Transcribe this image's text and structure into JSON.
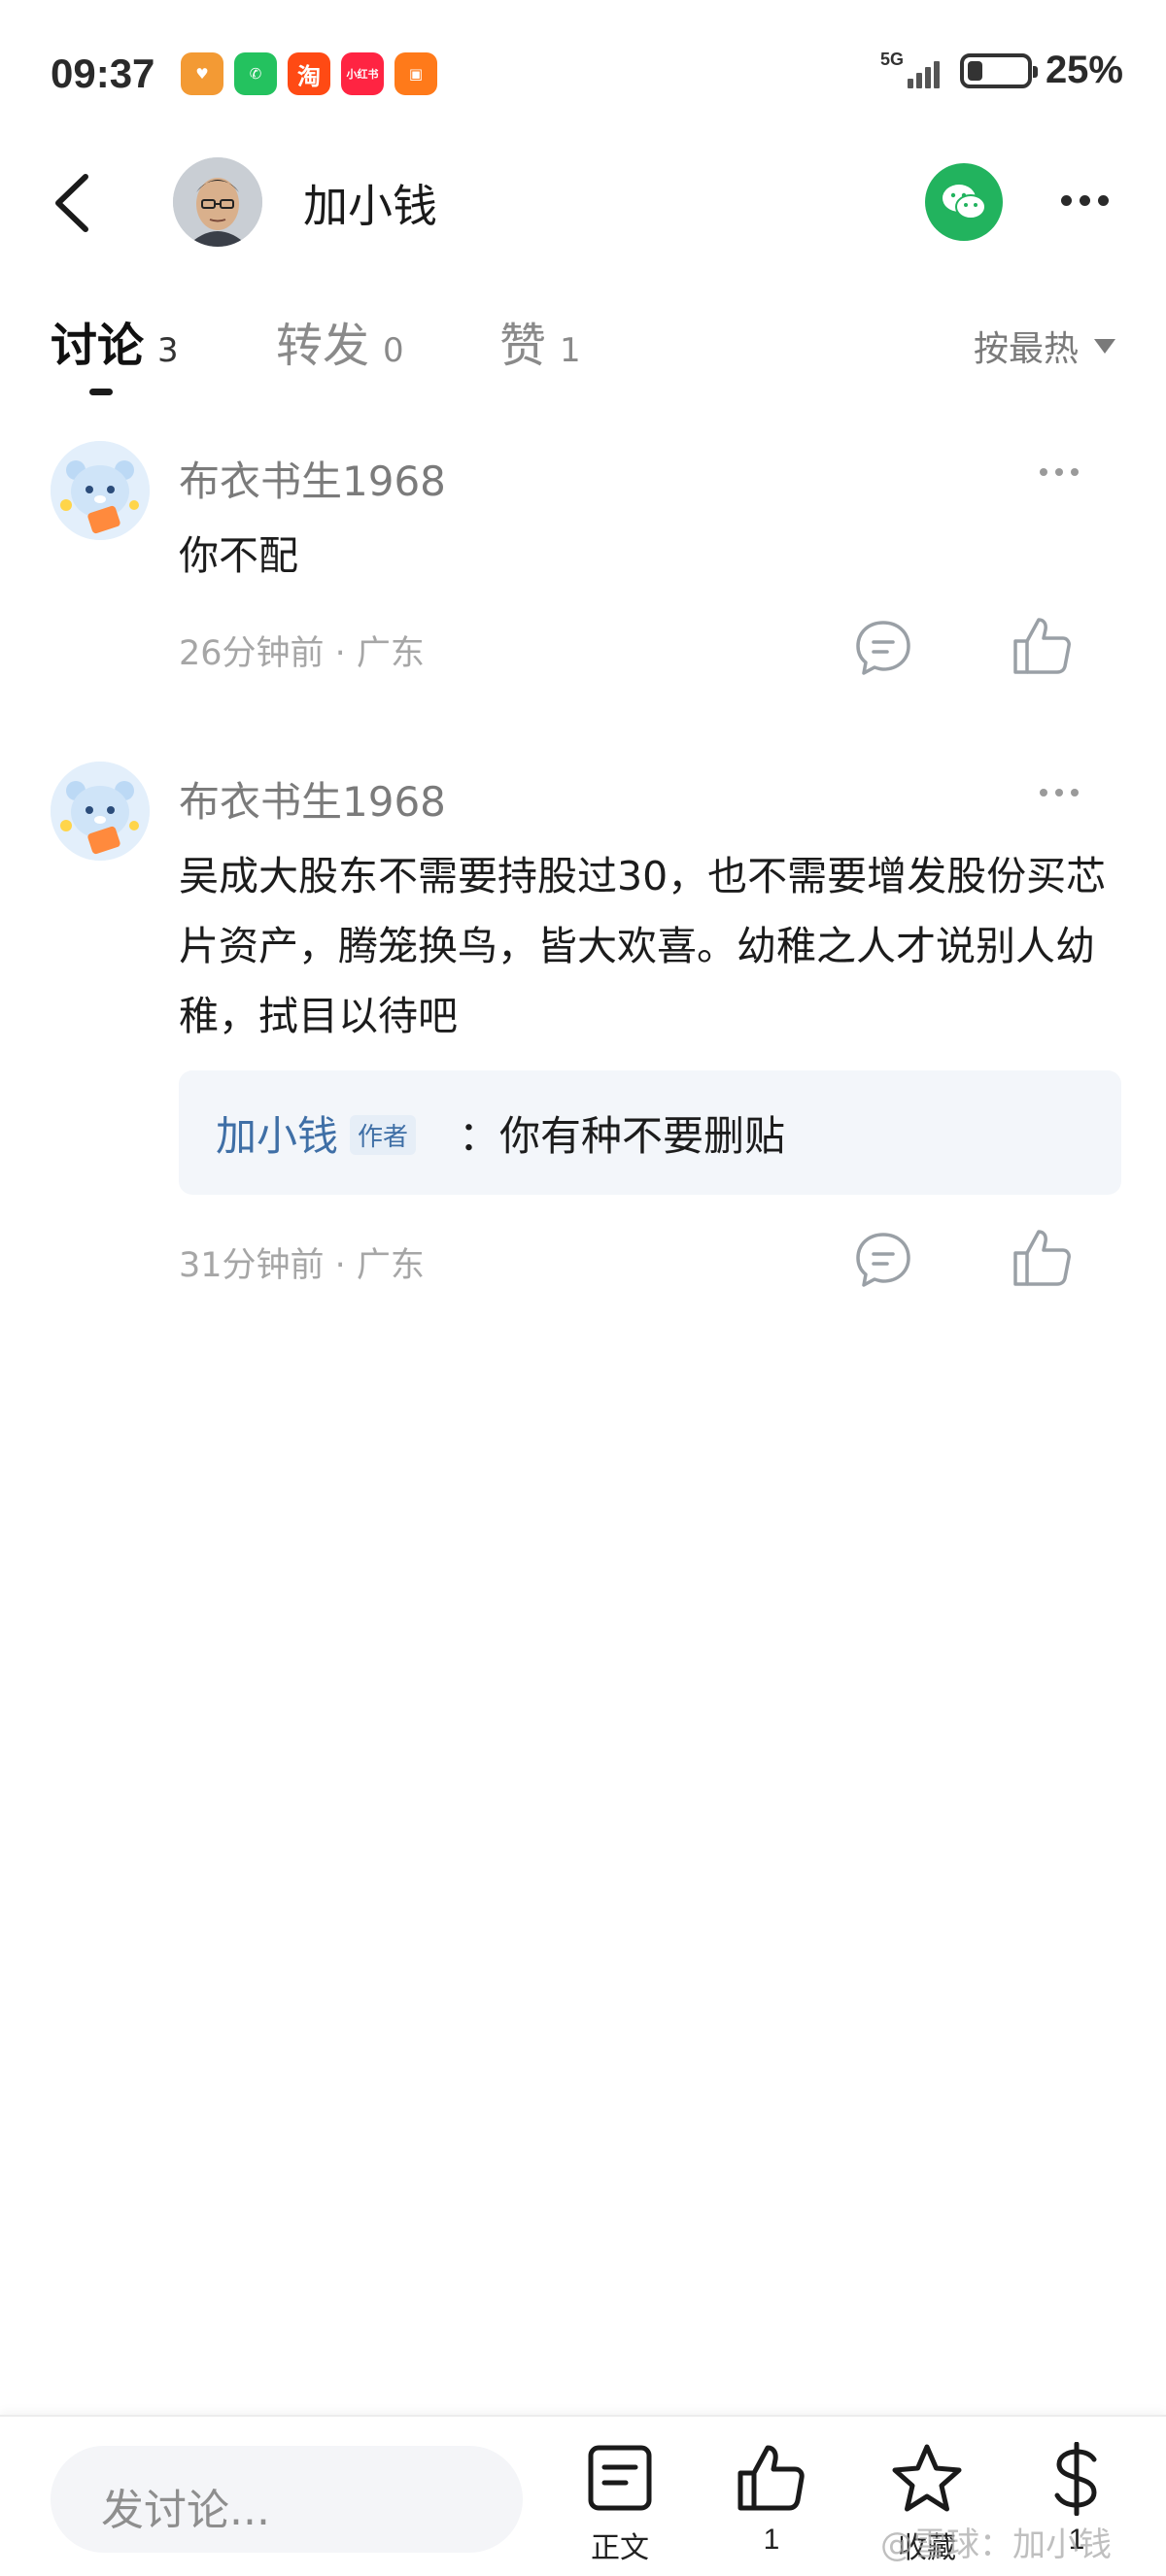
{
  "status_bar": {
    "time": "09:37",
    "network": "5G",
    "battery_percent_label": "25%",
    "battery_level": 0.25,
    "apps": [
      {
        "icon": "heart-app-icon",
        "color": "#f39a34",
        "text": "♥"
      },
      {
        "icon": "wechat-app-icon",
        "color": "#24c25f",
        "text": "✆"
      },
      {
        "icon": "taobao-app-icon",
        "color": "#ff4a14",
        "text": "淘"
      },
      {
        "icon": "xiaohongshu-app-icon",
        "color": "#ff2442",
        "text": "小红书"
      },
      {
        "icon": "gift-app-icon",
        "color": "#ff7a1a",
        "text": "▣"
      }
    ]
  },
  "header": {
    "title": "加小钱"
  },
  "tabs": [
    {
      "label": "讨论",
      "count": "3",
      "active": true
    },
    {
      "label": "转发",
      "count": "0",
      "active": false
    },
    {
      "label": "赞",
      "count": "1",
      "active": false
    }
  ],
  "sort": {
    "label": "按最热"
  },
  "comments": [
    {
      "author": "布衣书生1968",
      "text": "你不配",
      "meta": "26分钟前 · 广东"
    },
    {
      "author": "布衣书生1968",
      "text": "吴成大股东不需要持股过30，也不需要增发股份买芯片资产，腾笼换鸟，皆大欢喜。幼稚之人才说别人幼稚，拭目以待吧",
      "reply": {
        "author": "加小钱",
        "badge": "作者",
        "text": "：你有种不要删贴"
      },
      "meta": "31分钟前 · 广东"
    }
  ],
  "bottom_bar": {
    "input_placeholder": "发讨论...",
    "items": [
      {
        "icon": "article-icon",
        "label": "正文"
      },
      {
        "icon": "thumbs-up-icon",
        "label": "1"
      },
      {
        "icon": "star-icon",
        "label": "收藏"
      },
      {
        "icon": "dollar-icon",
        "label": "1"
      }
    ]
  },
  "watermark": "@雪球：加小钱",
  "colors": {
    "wechat_green": "#22b35e",
    "link_blue": "#3f6fa6",
    "muted_text": "#a6a6a6"
  }
}
